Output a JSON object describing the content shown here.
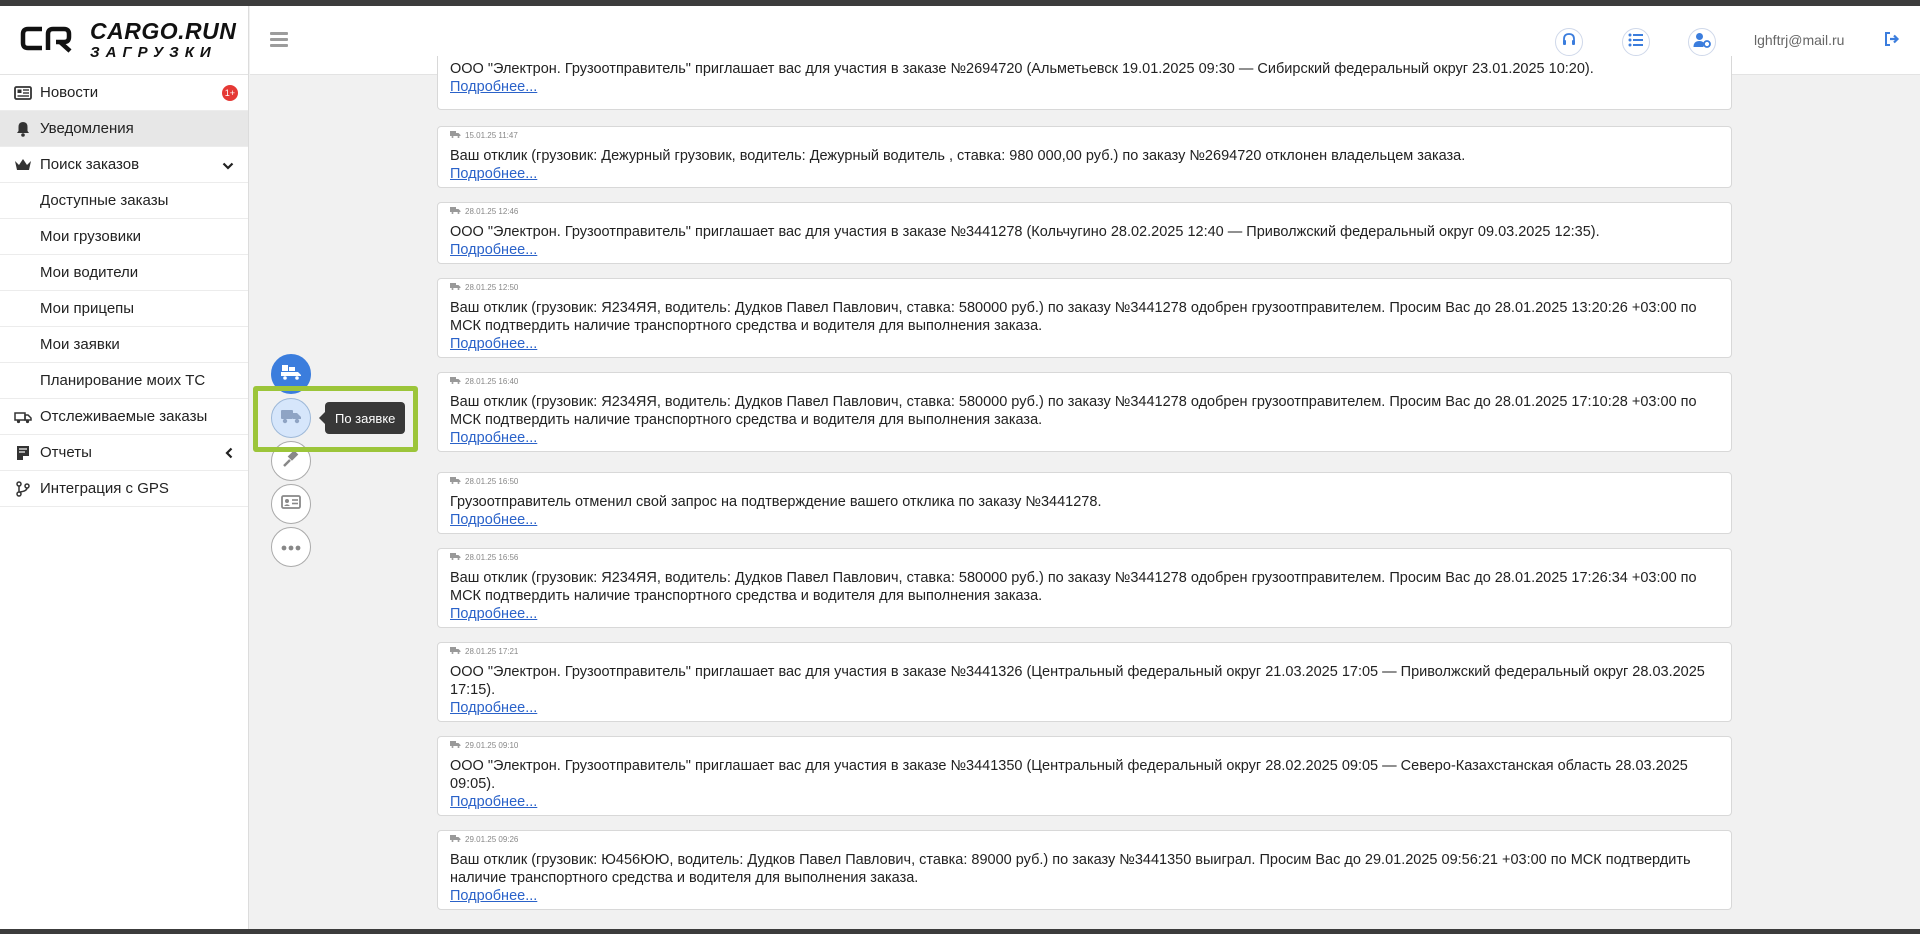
{
  "logo": {
    "main": "CARGO.RUN",
    "sub": "ЗАГРУЗКИ"
  },
  "sidebar": {
    "items": [
      {
        "label": "Новости",
        "badge": "1+"
      },
      {
        "label": "Уведомления"
      },
      {
        "label": "Поиск заказов"
      },
      {
        "label": "Доступные заказы"
      },
      {
        "label": "Мои грузовики"
      },
      {
        "label": "Мои водители"
      },
      {
        "label": "Мои прицепы"
      },
      {
        "label": "Мои заявки"
      },
      {
        "label": "Планирование моих ТС"
      },
      {
        "label": "Отслеживаемые заказы"
      },
      {
        "label": "Отчеты"
      },
      {
        "label": "Интеграция с GPS"
      }
    ]
  },
  "header": {
    "user_email": "lghftrj@mail.ru"
  },
  "tooltip": {
    "label": "По заявке"
  },
  "colors": {
    "accent": "#3b7ddd",
    "link": "#2a62c9",
    "highlight": "#9cc53a",
    "badge": "#e53935"
  },
  "notifications": [
    {
      "time": "",
      "text": "ООО \"Электрон. Грузоотправитель\" приглашает вас для участия в заказе №2694720 (Альметьевск 19.01.2025 09:30 — Сибирский федеральный округ 23.01.2025 10:20).",
      "link": "Подробнее..."
    },
    {
      "time": "15.01.25 11:47",
      "text": "Ваш отклик (грузовик: Дежурный грузовик, водитель: Дежурный водитель , ставка: 980 000,00 руб.) по заказу №2694720 отклонен владельцем заказа.",
      "link": "Подробнее..."
    },
    {
      "time": "28.01.25 12:46",
      "text": "ООО \"Электрон. Грузоотправитель\" приглашает вас для участия в заказе №3441278 (Кольчугино 28.02.2025 12:40 — Приволжский федеральный округ 09.03.2025 12:35).",
      "link": "Подробнее..."
    },
    {
      "time": "28.01.25 12:50",
      "text": "Ваш отклик (грузовик: Я234ЯЯ, водитель: Дудков Павел Павлович, ставка: 580000 руб.) по заказу №3441278 одобрен грузоотправителем. Просим Вас до 28.01.2025 13:20:26 +03:00 по МСК подтвердить наличие транспортного средства и водителя для выполнения заказа.",
      "link": "Подробнее..."
    },
    {
      "time": "28.01.25 16:40",
      "text": "Ваш отклик (грузовик: Я234ЯЯ, водитель: Дудков Павел Павлович, ставка: 580000 руб.) по заказу №3441278 одобрен грузоотправителем. Просим Вас до 28.01.2025 17:10:28 +03:00 по МСК подтвердить наличие транспортного средства и водителя для выполнения заказа.",
      "link": "Подробнее..."
    },
    {
      "time": "28.01.25 16:50",
      "text": "Грузоотправитель отменил свой запрос на подтверждение вашего отклика по заказу №3441278.",
      "link": "Подробнее..."
    },
    {
      "time": "28.01.25 16:56",
      "text": "Ваш отклик (грузовик: Я234ЯЯ, водитель: Дудков Павел Павлович, ставка: 580000 руб.) по заказу №3441278 одобрен грузоотправителем. Просим Вас до 28.01.2025 17:26:34 +03:00 по МСК подтвердить наличие транспортного средства и водителя для выполнения заказа.",
      "link": "Подробнее..."
    },
    {
      "time": "28.01.25 17:21",
      "text": "ООО \"Электрон. Грузоотправитель\" приглашает вас для участия в заказе №3441326 (Центральный федеральный округ 21.03.2025 17:05 — Приволжский федеральный округ 28.03.2025 17:15).",
      "link": "Подробнее..."
    },
    {
      "time": "29.01.25 09:10",
      "text": "ООО \"Электрон. Грузоотправитель\" приглашает вас для участия в заказе №3441350 (Центральный федеральный округ 28.02.2025 09:05 — Северо-Казахстанская область 28.03.2025 09:05).",
      "link": "Подробнее..."
    },
    {
      "time": "29.01.25 09:26",
      "text": "Ваш отклик (грузовик: Ю456ЮЮ, водитель: Дудков Павел Павлович, ставка: 89000 руб.) по заказу №3441350 выиграл. Просим Вас до 29.01.2025 09:56:21 +03:00 по МСК подтвердить наличие транспортного средства и водителя для выполнения заказа.",
      "link": "Подробнее..."
    }
  ]
}
